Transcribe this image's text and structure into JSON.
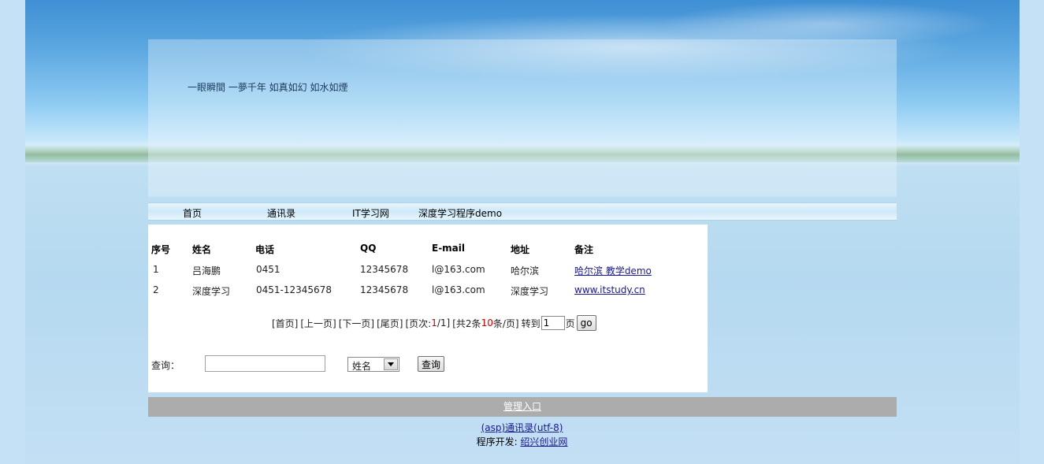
{
  "header": {
    "slogan": "一眼瞬間 一夢千年 如真如幻 如水如煙"
  },
  "nav": {
    "items": [
      {
        "label": "首页"
      },
      {
        "label": "通讯录"
      },
      {
        "label": "IT学习网"
      },
      {
        "label": "深度学习程序demo"
      }
    ]
  },
  "table": {
    "headers": [
      "序号",
      "姓名",
      "电话",
      "QQ",
      "E-mail",
      "地址",
      "备注"
    ],
    "rows": [
      {
        "id": "1",
        "name": "吕海鹏",
        "phone": "0451",
        "qq": "12345678",
        "email": "l@163.com",
        "address": "哈尔滨",
        "note": "哈尔滨 教学demo"
      },
      {
        "id": "2",
        "name": "深度学习",
        "phone": "0451-12345678",
        "qq": "12345678",
        "email": "l@163.com",
        "address": "深度学习",
        "note": "www.itstudy.cn"
      }
    ]
  },
  "pager": {
    "first": "[首页]",
    "prev": "[上一页]",
    "next": "[下一页]",
    "last": "[尾页]",
    "page_prefix": "[页次:",
    "page_current": "1",
    "page_sep": "/1]",
    "total_prefix": "[共2条 ",
    "per_page": "10",
    "per_page_suffix": "条/页]",
    "goto_label": "转到",
    "goto_value": "1",
    "page_unit": "页",
    "go_button": "go"
  },
  "search": {
    "label": "查询：",
    "input_value": "",
    "field_selected": "姓名",
    "button": "查询"
  },
  "footer": {
    "admin_link": "管理入口",
    "app_name": "(asp)通讯录(utf-8)",
    "dev_prefix": "程序开发: ",
    "dev_link": "绍兴创业网"
  },
  "colors": {
    "footer_bar": "#acacac",
    "link": "#1a1a8c",
    "highlight": "#cc0000"
  }
}
